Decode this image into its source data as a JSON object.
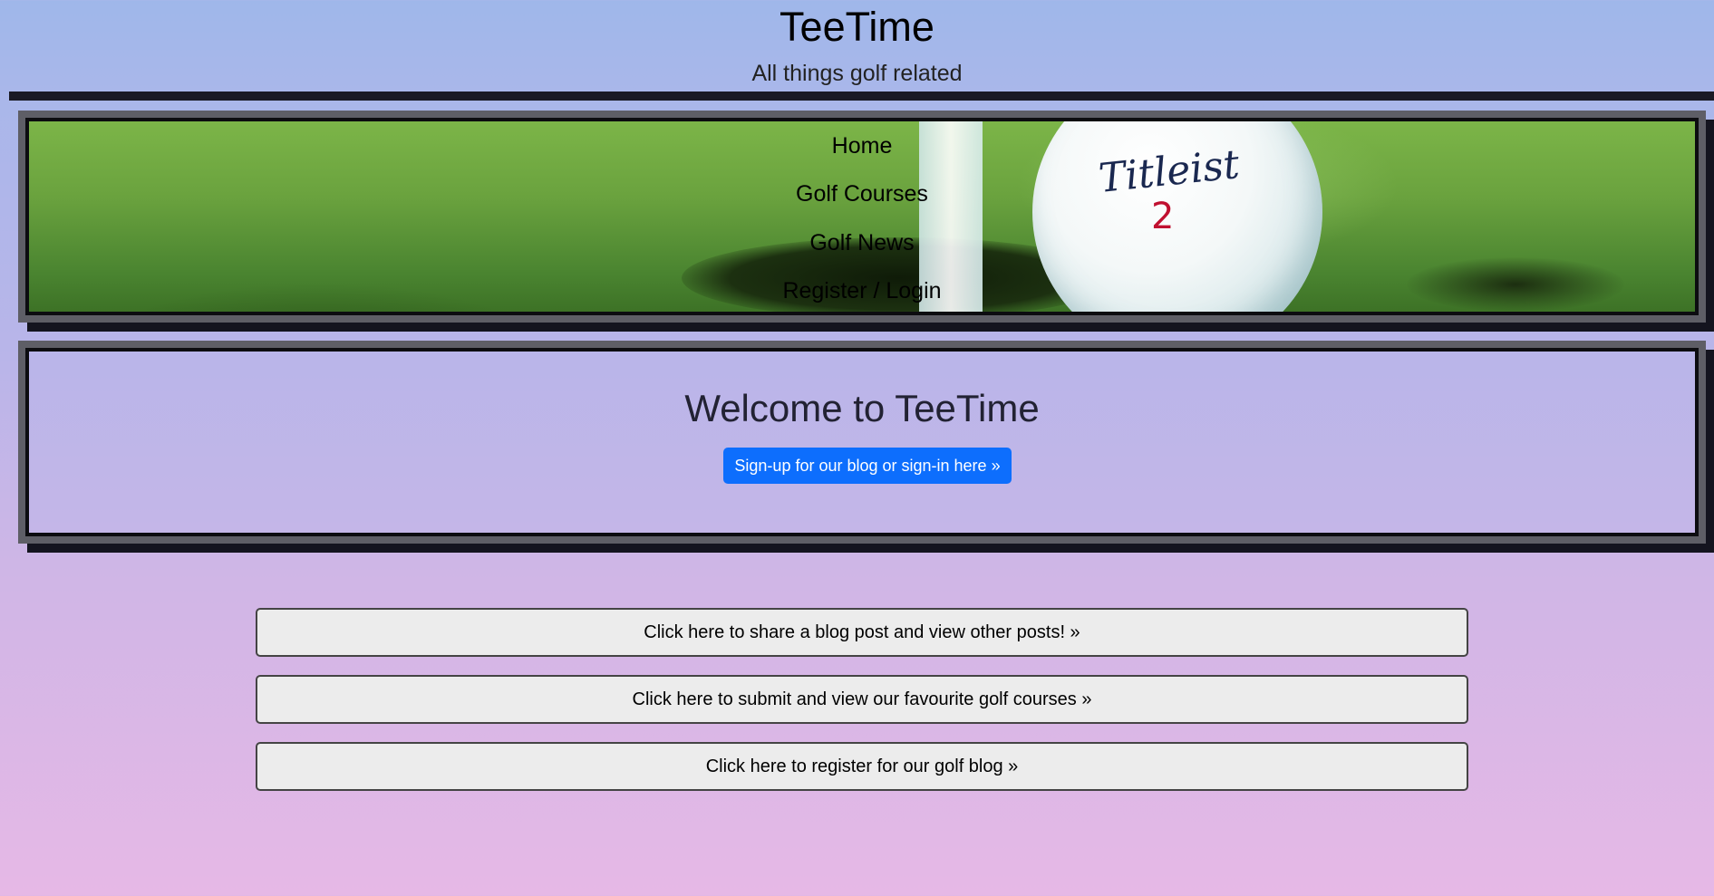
{
  "header": {
    "title": "TeeTime",
    "tagline": "All things golf related"
  },
  "nav": {
    "items": [
      {
        "label": "Home"
      },
      {
        "label": "Golf Courses"
      },
      {
        "label": "Golf News"
      },
      {
        "label": "Register / Login"
      }
    ],
    "banner_image": {
      "brand_text": "Titleist",
      "number_text": "2"
    }
  },
  "welcome": {
    "title": "Welcome to TeeTime",
    "signup_label": "Sign-up for our blog or sign-in here »"
  },
  "actions": [
    {
      "label": "Click here to share a blog post and view other posts! »"
    },
    {
      "label": "Click here to submit and view our favourite golf courses »"
    },
    {
      "label": "Click here to register for our golf blog »"
    }
  ],
  "colors": {
    "primary_button": "#0d6efd",
    "frame_dark": "#14141f",
    "frame_border": "#5e5e66",
    "action_button_bg": "#ececec"
  }
}
